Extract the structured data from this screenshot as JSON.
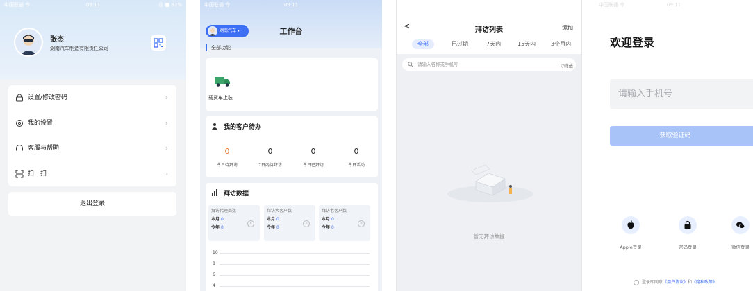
{
  "statusbar": {
    "s1_left": "中国联通 令",
    "s1_time": "09:11",
    "s1_right": "@ ■ 87%",
    "s2_left": "中国联通 令",
    "s2_time": "09:11",
    "s4_left": "中国联通 令",
    "s4_time": "09:11"
  },
  "profile": {
    "name": "张杰",
    "company": "湖南汽车制造有限责任公司",
    "menu": [
      {
        "label": "设置/修改密码",
        "icon": "lock-icon"
      },
      {
        "label": "我的设置",
        "icon": "settings-icon"
      },
      {
        "label": "客服与帮助",
        "icon": "headset-icon"
      },
      {
        "label": "扫一扫",
        "icon": "scan-icon"
      }
    ],
    "logout": "退出登录"
  },
  "workbench": {
    "org": "湖南汽车",
    "title": "工作台",
    "all_functions": "全部功能",
    "truck_label": "载货车上装",
    "todo_title": "我的客户待办",
    "kpis": [
      {
        "value": "0",
        "label": "今日待拜访",
        "color": "#e8772e"
      },
      {
        "value": "0",
        "label": "7日内待拜访",
        "color": "#222222"
      },
      {
        "value": "0",
        "label": "今日已拜访",
        "color": "#222222"
      },
      {
        "value": "0",
        "label": "今日活动",
        "color": "#222222"
      }
    ],
    "visit_title": "拜访数据",
    "visit_boxes": [
      {
        "title": "拜访代理商数",
        "month_label": "本月",
        "month": "0",
        "year_label": "今年",
        "year": "0"
      },
      {
        "title": "拜访大客户数",
        "month_label": "本月",
        "month": "0",
        "year_label": "今年",
        "year": "0"
      },
      {
        "title": "拜访老客户数",
        "month_label": "本月",
        "month": "0",
        "year_label": "今年",
        "year": "0"
      }
    ],
    "y_ticks": [
      "10",
      "8",
      "6",
      "4"
    ]
  },
  "visits": {
    "title": "拜访列表",
    "add": "添加",
    "tabs": [
      "全部",
      "已过期",
      "7天内",
      "15天内",
      "3个月内"
    ],
    "search_placeholder": "请输入名称或手机号",
    "filter": "筛选",
    "empty_text": "暂无拜访数据"
  },
  "login": {
    "welcome": "欢迎登录",
    "phone_placeholder": "请输入手机号",
    "get_code": "获取验证码",
    "options": [
      {
        "label": "Apple登录",
        "icon": "apple-icon"
      },
      {
        "label": "密码登录",
        "icon": "lock-icon"
      },
      {
        "label": "微信登录",
        "icon": "wechat-icon"
      }
    ],
    "agree_prefix": "登录即同意",
    "agree_link1": "《用户协议》",
    "agree_mid": "和",
    "agree_link2": "《隐私政策》"
  },
  "colors": {
    "accent": "#3d6ff4",
    "orange": "#e8772e"
  }
}
